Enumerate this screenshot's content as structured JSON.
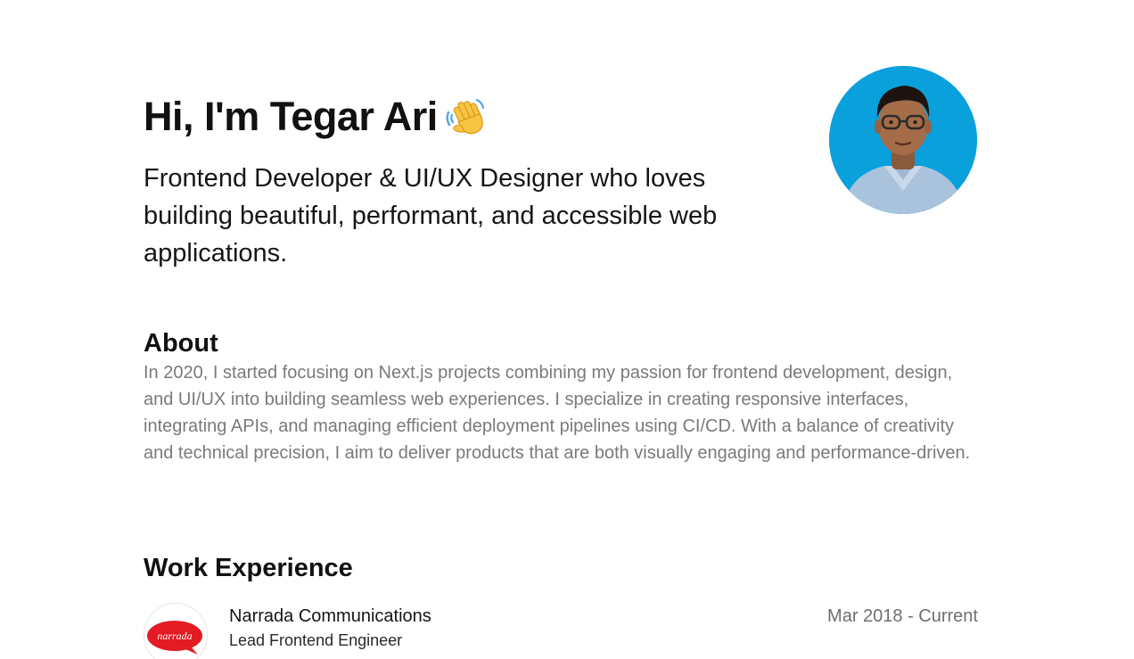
{
  "hero": {
    "title": "Hi, I'm Tegar Ari",
    "subtitle": "Frontend Developer & UI/UX Designer who loves building beautiful, performant, and accessible web applications."
  },
  "icons": {
    "wave": "waving-hand-icon",
    "avatar": "profile-photo",
    "company_logo": "narrada-logo"
  },
  "about": {
    "heading": "About",
    "text": "In 2020, I started focusing on Next.js projects combining my passion for frontend development, design, and UI/UX into building seamless web experiences. I specialize in creating responsive interfaces, integrating APIs, and managing efficient deployment pipelines using CI/CD. With a balance of creativity and technical precision, I aim to deliver products that are both visually engaging and performance-driven."
  },
  "work": {
    "heading": "Work Experience",
    "jobs": [
      {
        "company": "Narrada Communications",
        "logo_text": "narrada",
        "role": "Lead Frontend Engineer",
        "dates": "Mar 2018 - Current"
      }
    ]
  },
  "colors": {
    "text_primary": "#111111",
    "text_muted": "#7a7a7a",
    "avatar_bg": "#0aa0dc",
    "logo_red": "#e31b23"
  }
}
